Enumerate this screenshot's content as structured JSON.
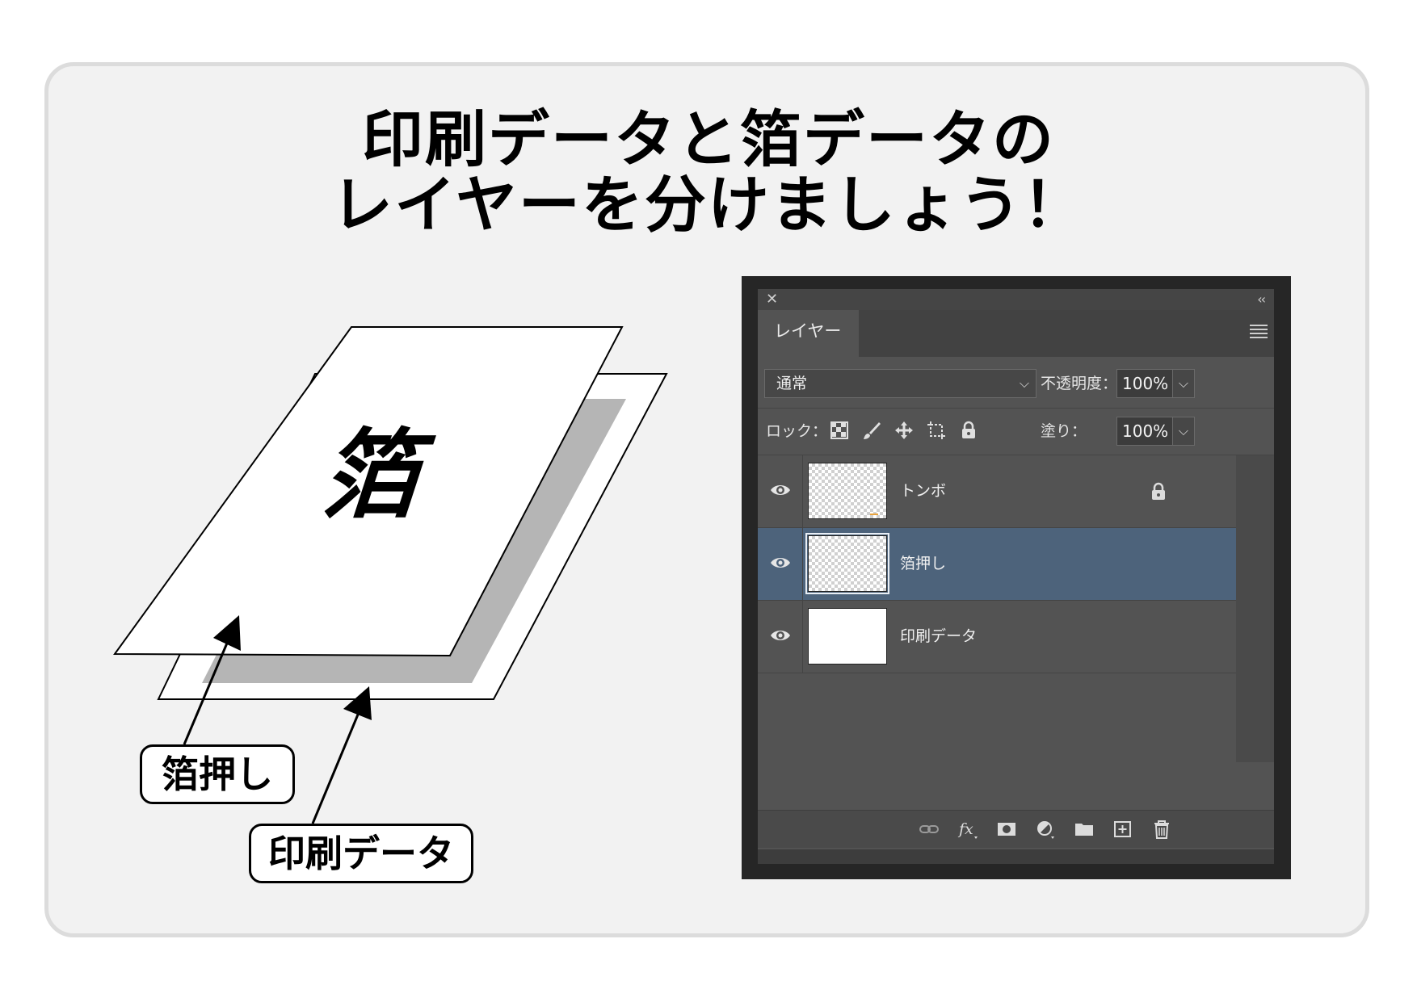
{
  "headline": {
    "line1": "印刷データと箔データの",
    "line2": "レイヤーを分けましょう！"
  },
  "illustration": {
    "foil_glyph": "箔",
    "callout_foil": "箔押し",
    "callout_print": "印刷データ"
  },
  "layers_panel": {
    "tab_label": "レイヤー",
    "blend_mode": "通常",
    "opacity_label": "不透明度：",
    "opacity_value": "100%",
    "lock_label": "ロック：",
    "fill_label": "塗り：",
    "fill_value": "100%",
    "layers": [
      {
        "name": "トンボ",
        "visible": true,
        "locked": true,
        "selected": false
      },
      {
        "name": "箔押し",
        "visible": true,
        "locked": false,
        "selected": true
      },
      {
        "name": "印刷データ",
        "visible": true,
        "locked": false,
        "selected": false
      }
    ],
    "bottom_icons": [
      "link-icon",
      "fx-icon",
      "mask-icon",
      "adjustment-icon",
      "folder-icon",
      "new-layer-icon",
      "trash-icon"
    ],
    "selected_color": "#4d637b"
  }
}
